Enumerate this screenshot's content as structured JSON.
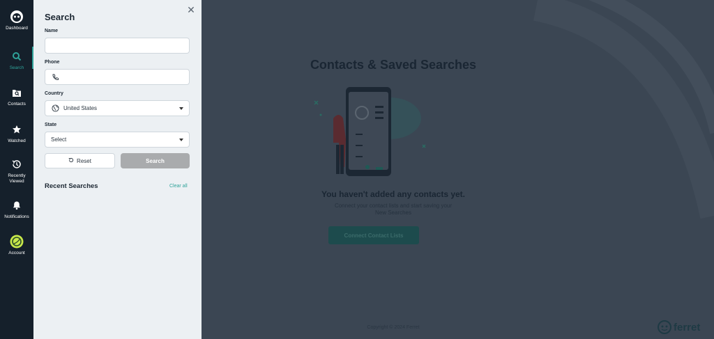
{
  "nav": {
    "items": [
      {
        "label": "Dashboard",
        "icon": "logo-icon"
      },
      {
        "label": "Search",
        "icon": "search-icon"
      },
      {
        "label": "Contacts",
        "icon": "contacts-folder-icon"
      },
      {
        "label": "Watched",
        "icon": "star-icon"
      },
      {
        "label": "Recently Viewed",
        "icon": "history-icon"
      },
      {
        "label": "Notifications",
        "icon": "bell-icon"
      },
      {
        "label": "Account",
        "icon": "avatar-icon"
      }
    ]
  },
  "search_panel": {
    "title": "Search",
    "name_label": "Name",
    "name_value": "",
    "phone_label": "Phone",
    "phone_value": "",
    "country_label": "Country",
    "country_value": "United States",
    "state_label": "State",
    "state_value": "Select",
    "reset_label": "Reset",
    "search_label": "Search",
    "recent_title": "Recent Searches",
    "clear_all_label": "Clear all"
  },
  "main": {
    "title": "Contacts & Saved Searches",
    "empty_title": "You haven't added any contacts yet.",
    "empty_subtitle_1": "Connect your contact lists and start saving your",
    "empty_subtitle_2": "New Searches",
    "connect_button": "Connect Contact Lists",
    "copyright": "Copyright © 2024 Ferret",
    "logo_text": "ferret"
  },
  "colors": {
    "rail_bg": "#15202b",
    "panel_bg": "#ecf0f3",
    "accent": "#2fa39a",
    "overlay_bg": "#3b4653"
  }
}
